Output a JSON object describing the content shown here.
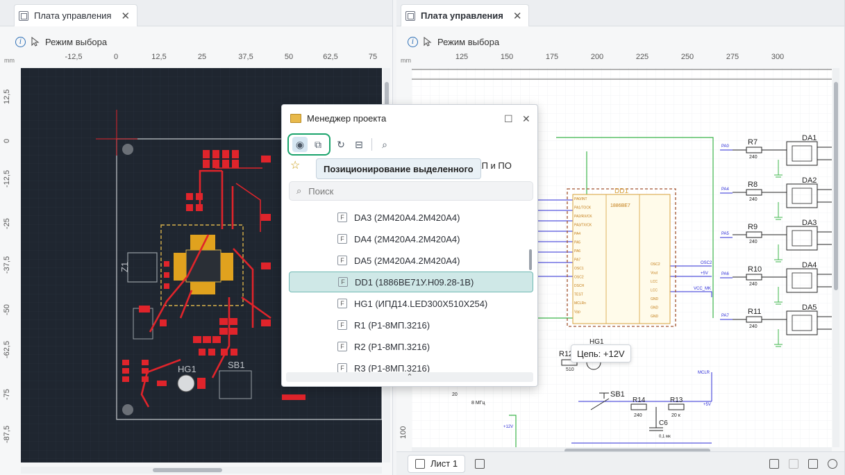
{
  "left_tab": {
    "title": "Плата управления",
    "close": "✕"
  },
  "right_tab": {
    "title": "Плата управления",
    "close": "✕"
  },
  "toolbar": {
    "mode_label": "Режим выбора"
  },
  "ruler_unit": "mm",
  "left_ruler_h": [
    "-12,5",
    "0",
    "12,5",
    "25",
    "37,5",
    "50",
    "62,5",
    "75"
  ],
  "left_ruler_v": [
    "12,5",
    "0",
    "-12,5",
    "-25",
    "-37,5",
    "-50",
    "-62,5",
    "-75",
    "-87,5"
  ],
  "right_ruler_h": [
    "125",
    "150",
    "175",
    "200",
    "225",
    "250",
    "275",
    "300"
  ],
  "right_ruler_v": [
    "100"
  ],
  "pcb": {
    "z1": "Z1",
    "hg1": "HG1",
    "sb1": "SB1"
  },
  "schematic": {
    "resistors": [
      {
        "ref": "R7",
        "val": "240",
        "net": "PA0",
        "da": "DA1"
      },
      {
        "ref": "R8",
        "val": "240",
        "net": "PA4",
        "da": "DA2"
      },
      {
        "ref": "R9",
        "val": "240",
        "net": "PA5",
        "da": "DA3"
      },
      {
        "ref": "R10",
        "val": "240",
        "net": "PA6",
        "da": "DA4"
      },
      {
        "ref": "R11",
        "val": "240",
        "net": "PA7",
        "da": "DA5"
      }
    ],
    "dd1_ref": "DD1",
    "dd1_part": "1886BE7",
    "dd1_left_pins": [
      "PA0/INT",
      "PA1/TOCK",
      "PA2/RX/CK",
      "PA3/TX/CK",
      "PA4",
      "PA5",
      "PA6",
      "PA7",
      "OSC1",
      "OSC2",
      "DSCH",
      "TEST",
      "MCLRn",
      "Vpp"
    ],
    "dd1_right_pins": [
      "OSC2",
      "Vout",
      "LCC",
      "LCC",
      "GND",
      "GND",
      "GND"
    ],
    "nets_right": [
      "OSC2",
      "+5V",
      "VCC_MK"
    ],
    "r12": {
      "ref": "R12",
      "val": "510"
    },
    "hg1": "HG1",
    "sb1": "SB1",
    "r14": {
      "ref": "R14",
      "val": "240"
    },
    "r13": {
      "ref": "R13",
      "val": "20 к"
    },
    "c6": {
      "ref": "C6",
      "val": "0,1 мк"
    },
    "crystal": "8 МГц",
    "c_small": "20",
    "mclr": "MCLR",
    "p5v": "+5V",
    "p12v": "+12V",
    "net_tooltip": "Цепь: +12V"
  },
  "sheet_tab": "Лист 1",
  "dialog": {
    "title": "Менеджер проекта",
    "tooltip": "Позиционирование выделенного",
    "tab_partial": "КП и ПО",
    "search_placeholder": "Поиск",
    "items": [
      "DA3 (2M420A4.2M420A4)",
      "DA4 (2M420A4.2M420A4)",
      "DA5 (2M420A4.2M420A4)",
      "DD1 (1886BE71У.H09.28-1B)",
      "HG1 (ИПД14.LED300X510X254)",
      "R1 (P1-8MП.3216)",
      "R2 (P1-8MП.3216)",
      "R3 (P1-8MП.3216)"
    ],
    "selected_index": 3
  },
  "colors": {
    "accent": "#19a36b",
    "selection": "#cfe8e7",
    "pcb_bg": "#1f2630",
    "copper": "#e0242b",
    "silk": "#d7b14a"
  }
}
